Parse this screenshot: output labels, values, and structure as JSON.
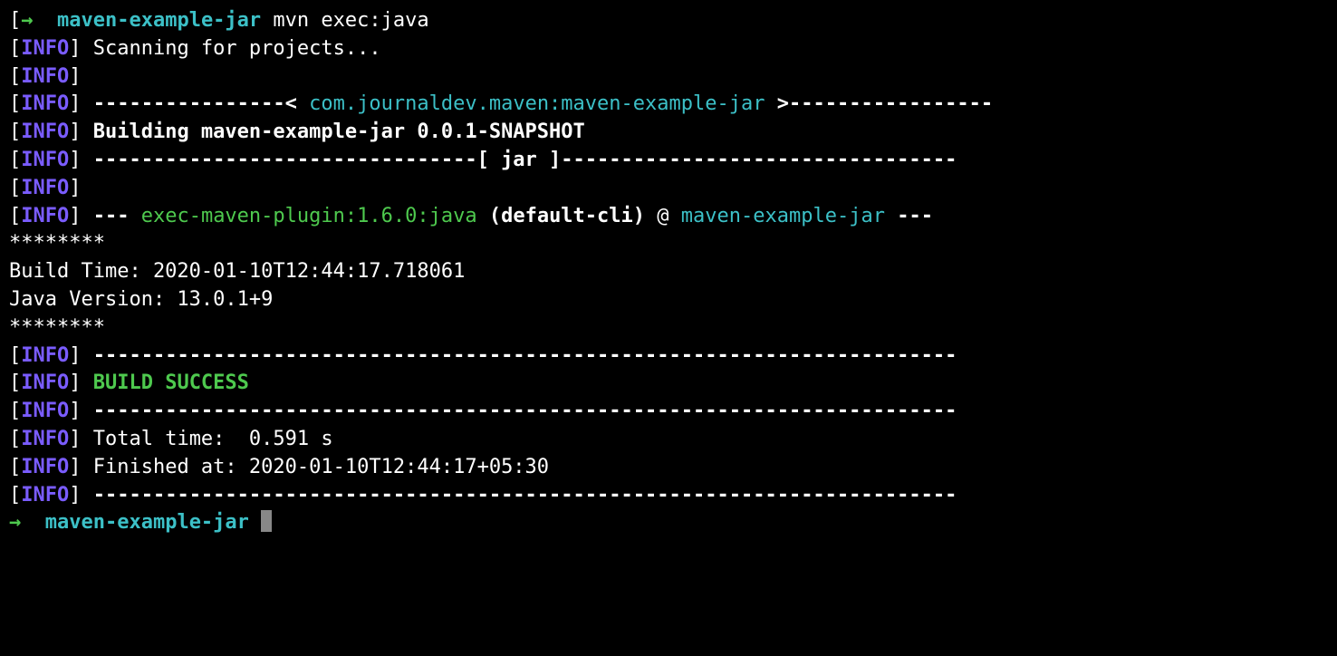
{
  "prompt1": {
    "open_bracket": "[",
    "arrow": "→",
    "dir": "maven-example-jar",
    "command": "mvn exec:java"
  },
  "lines": {
    "l1_info": "INFO",
    "l1_text": " Scanning for projects...",
    "l2_info": "INFO",
    "l3_info": "INFO",
    "l3_dash1": " ----------------< ",
    "l3_artifact": "com.journaldev.maven:maven-example-jar",
    "l3_dash2": " >-----------------",
    "l4_info": "INFO",
    "l4_text": " Building maven-example-jar 0.0.1-SNAPSHOT",
    "l5_info": "INFO",
    "l5_text": " --------------------------------[ jar ]---------------------------------",
    "l6_info": "INFO",
    "l7_info": "INFO",
    "l7_dash1": " --- ",
    "l7_plugin": "exec-maven-plugin:1.6.0:java",
    "l7_default": " (default-cli)",
    "l7_at": " @ ",
    "l7_project": "maven-example-jar",
    "l7_dash2": " ---",
    "l8": "********",
    "l9": "Build Time: 2020-01-10T12:44:17.718061",
    "l10": "Java Version: 13.0.1+9",
    "l11": "********",
    "l12_info": "INFO",
    "l12_text": " ------------------------------------------------------------------------",
    "l13_info": "INFO",
    "l13_text": " BUILD SUCCESS",
    "l14_info": "INFO",
    "l14_text": " ------------------------------------------------------------------------",
    "l15_info": "INFO",
    "l15_text": " Total time:  0.591 s",
    "l16_info": "INFO",
    "l16_text": " Finished at: 2020-01-10T12:44:17+05:30",
    "l17_info": "INFO",
    "l17_text": " ------------------------------------------------------------------------"
  },
  "prompt2": {
    "arrow": "→",
    "dir": "maven-example-jar"
  },
  "br": {
    "open": "[",
    "close": "]"
  }
}
